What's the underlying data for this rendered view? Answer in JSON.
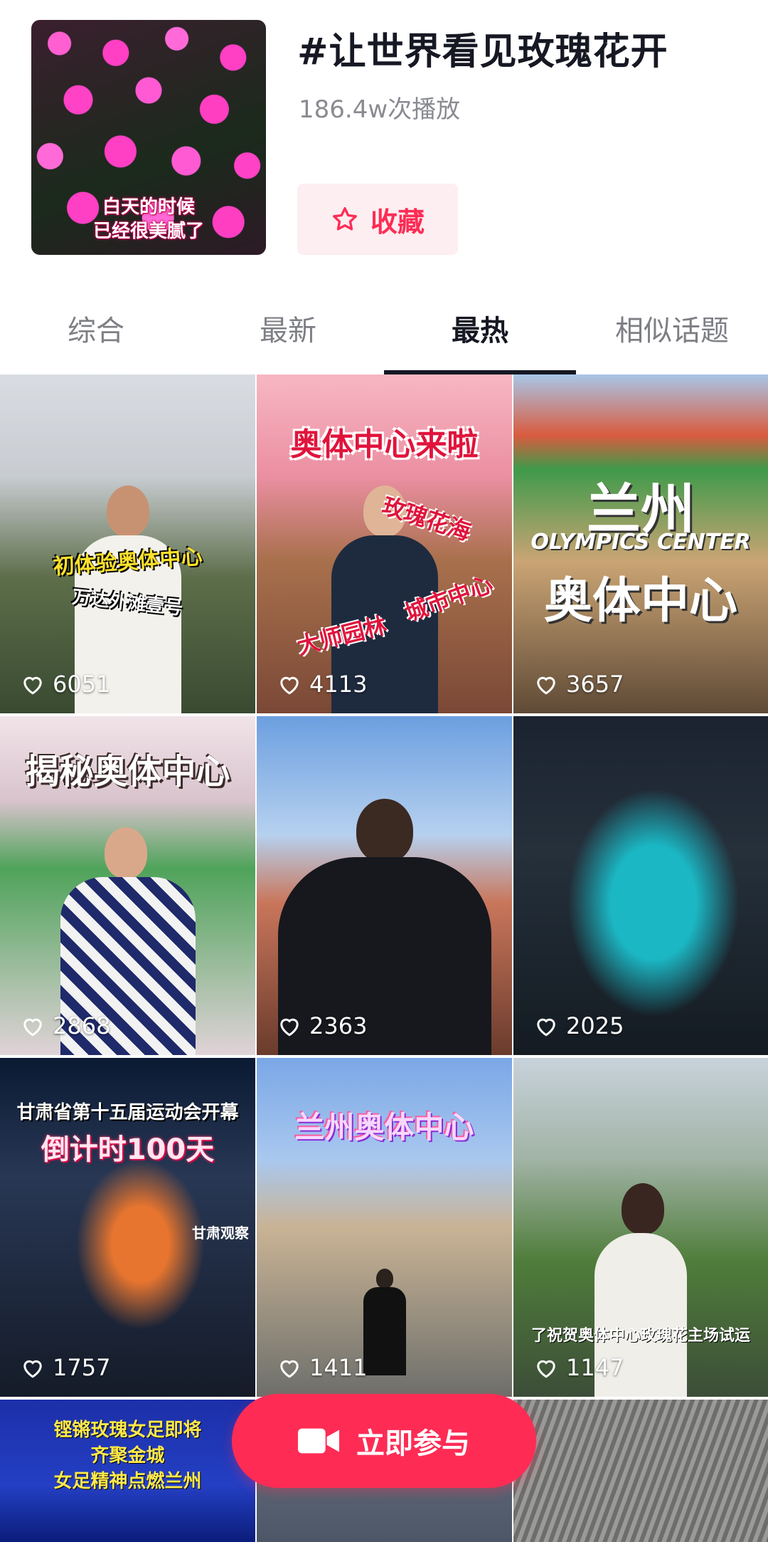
{
  "topic": {
    "title": "#让世界看见玫瑰花开",
    "play_count": "186.4w次播放",
    "cover_caption": [
      "白天的时候",
      "已经很美腻了"
    ],
    "favorite_label": "收藏"
  },
  "tabs": [
    {
      "label": "综合",
      "active": false
    },
    {
      "label": "最新",
      "active": false
    },
    {
      "label": "最热",
      "active": true
    },
    {
      "label": "相似话题",
      "active": false
    }
  ],
  "videos": [
    {
      "likes": "6051",
      "captions": [
        "初体验奥体中心",
        "万达外滩壹号"
      ]
    },
    {
      "likes": "4113",
      "captions": [
        "奥体中心来啦",
        "玫瑰花海",
        "城市中心",
        "大师园林"
      ]
    },
    {
      "likes": "3657",
      "captions": [
        "兰州",
        "OLYMPICS CENTER",
        "奥体中心"
      ]
    },
    {
      "likes": "2868",
      "captions": [
        "揭秘奥体中心"
      ]
    },
    {
      "likes": "2363",
      "captions": []
    },
    {
      "likes": "2025",
      "captions": []
    },
    {
      "likes": "1757",
      "captions": [
        "甘肃省第十五届运动会开幕",
        "倒计时100天",
        "甘肃观察"
      ]
    },
    {
      "likes": "1411",
      "captions": [
        "兰州奥体中心"
      ]
    },
    {
      "likes": "1147",
      "captions": [
        "了祝贺奥体中心玫瑰花主场试运"
      ]
    },
    {
      "likes": "",
      "captions": [
        "铿锵玫瑰女足即将",
        "齐聚金城",
        "女足精神点燃兰州"
      ]
    },
    {
      "likes": "",
      "captions": []
    },
    {
      "likes": "",
      "captions": []
    }
  ],
  "join_button": {
    "label": "立即参与"
  },
  "colors": {
    "accent": "#fe2c55",
    "accent_light": "#fdeef1",
    "text_primary": "#161823",
    "text_secondary": "#8a8b91"
  },
  "icons": {
    "favorite": "star-outline-icon",
    "like": "heart-outline-icon",
    "join": "video-camera-icon"
  }
}
